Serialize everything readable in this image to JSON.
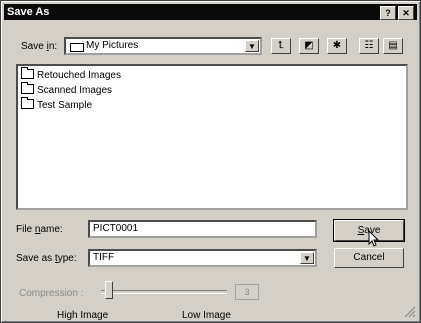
{
  "window": {
    "title": "Save As",
    "help_btn": "?",
    "close_btn": "✕"
  },
  "savein": {
    "label_pre": "Save ",
    "label_key": "i",
    "label_post": "n:",
    "value": "My Pictures"
  },
  "toolbar": {
    "dropdown_arrow": "▼",
    "up_icon": "⮤",
    "desktop_icon": "◩",
    "newfolder_icon": "✱",
    "list_icon": "☷",
    "details_icon": "▤"
  },
  "files": [
    "Retouched Images",
    "Scanned Images",
    "Test Sample"
  ],
  "filename": {
    "label_pre": "File ",
    "label_key": "n",
    "label_post": "ame:",
    "value": "PICT0001"
  },
  "savetype": {
    "label_pre": "Save as ",
    "label_key": "t",
    "label_post": "ype:",
    "value": "TIFF"
  },
  "buttons": {
    "save_key": "S",
    "save_rest": "ave",
    "cancel": "Cancel"
  },
  "compression": {
    "label": "Compression :",
    "value": "3",
    "high": "High Image",
    "low": "Low Image"
  }
}
